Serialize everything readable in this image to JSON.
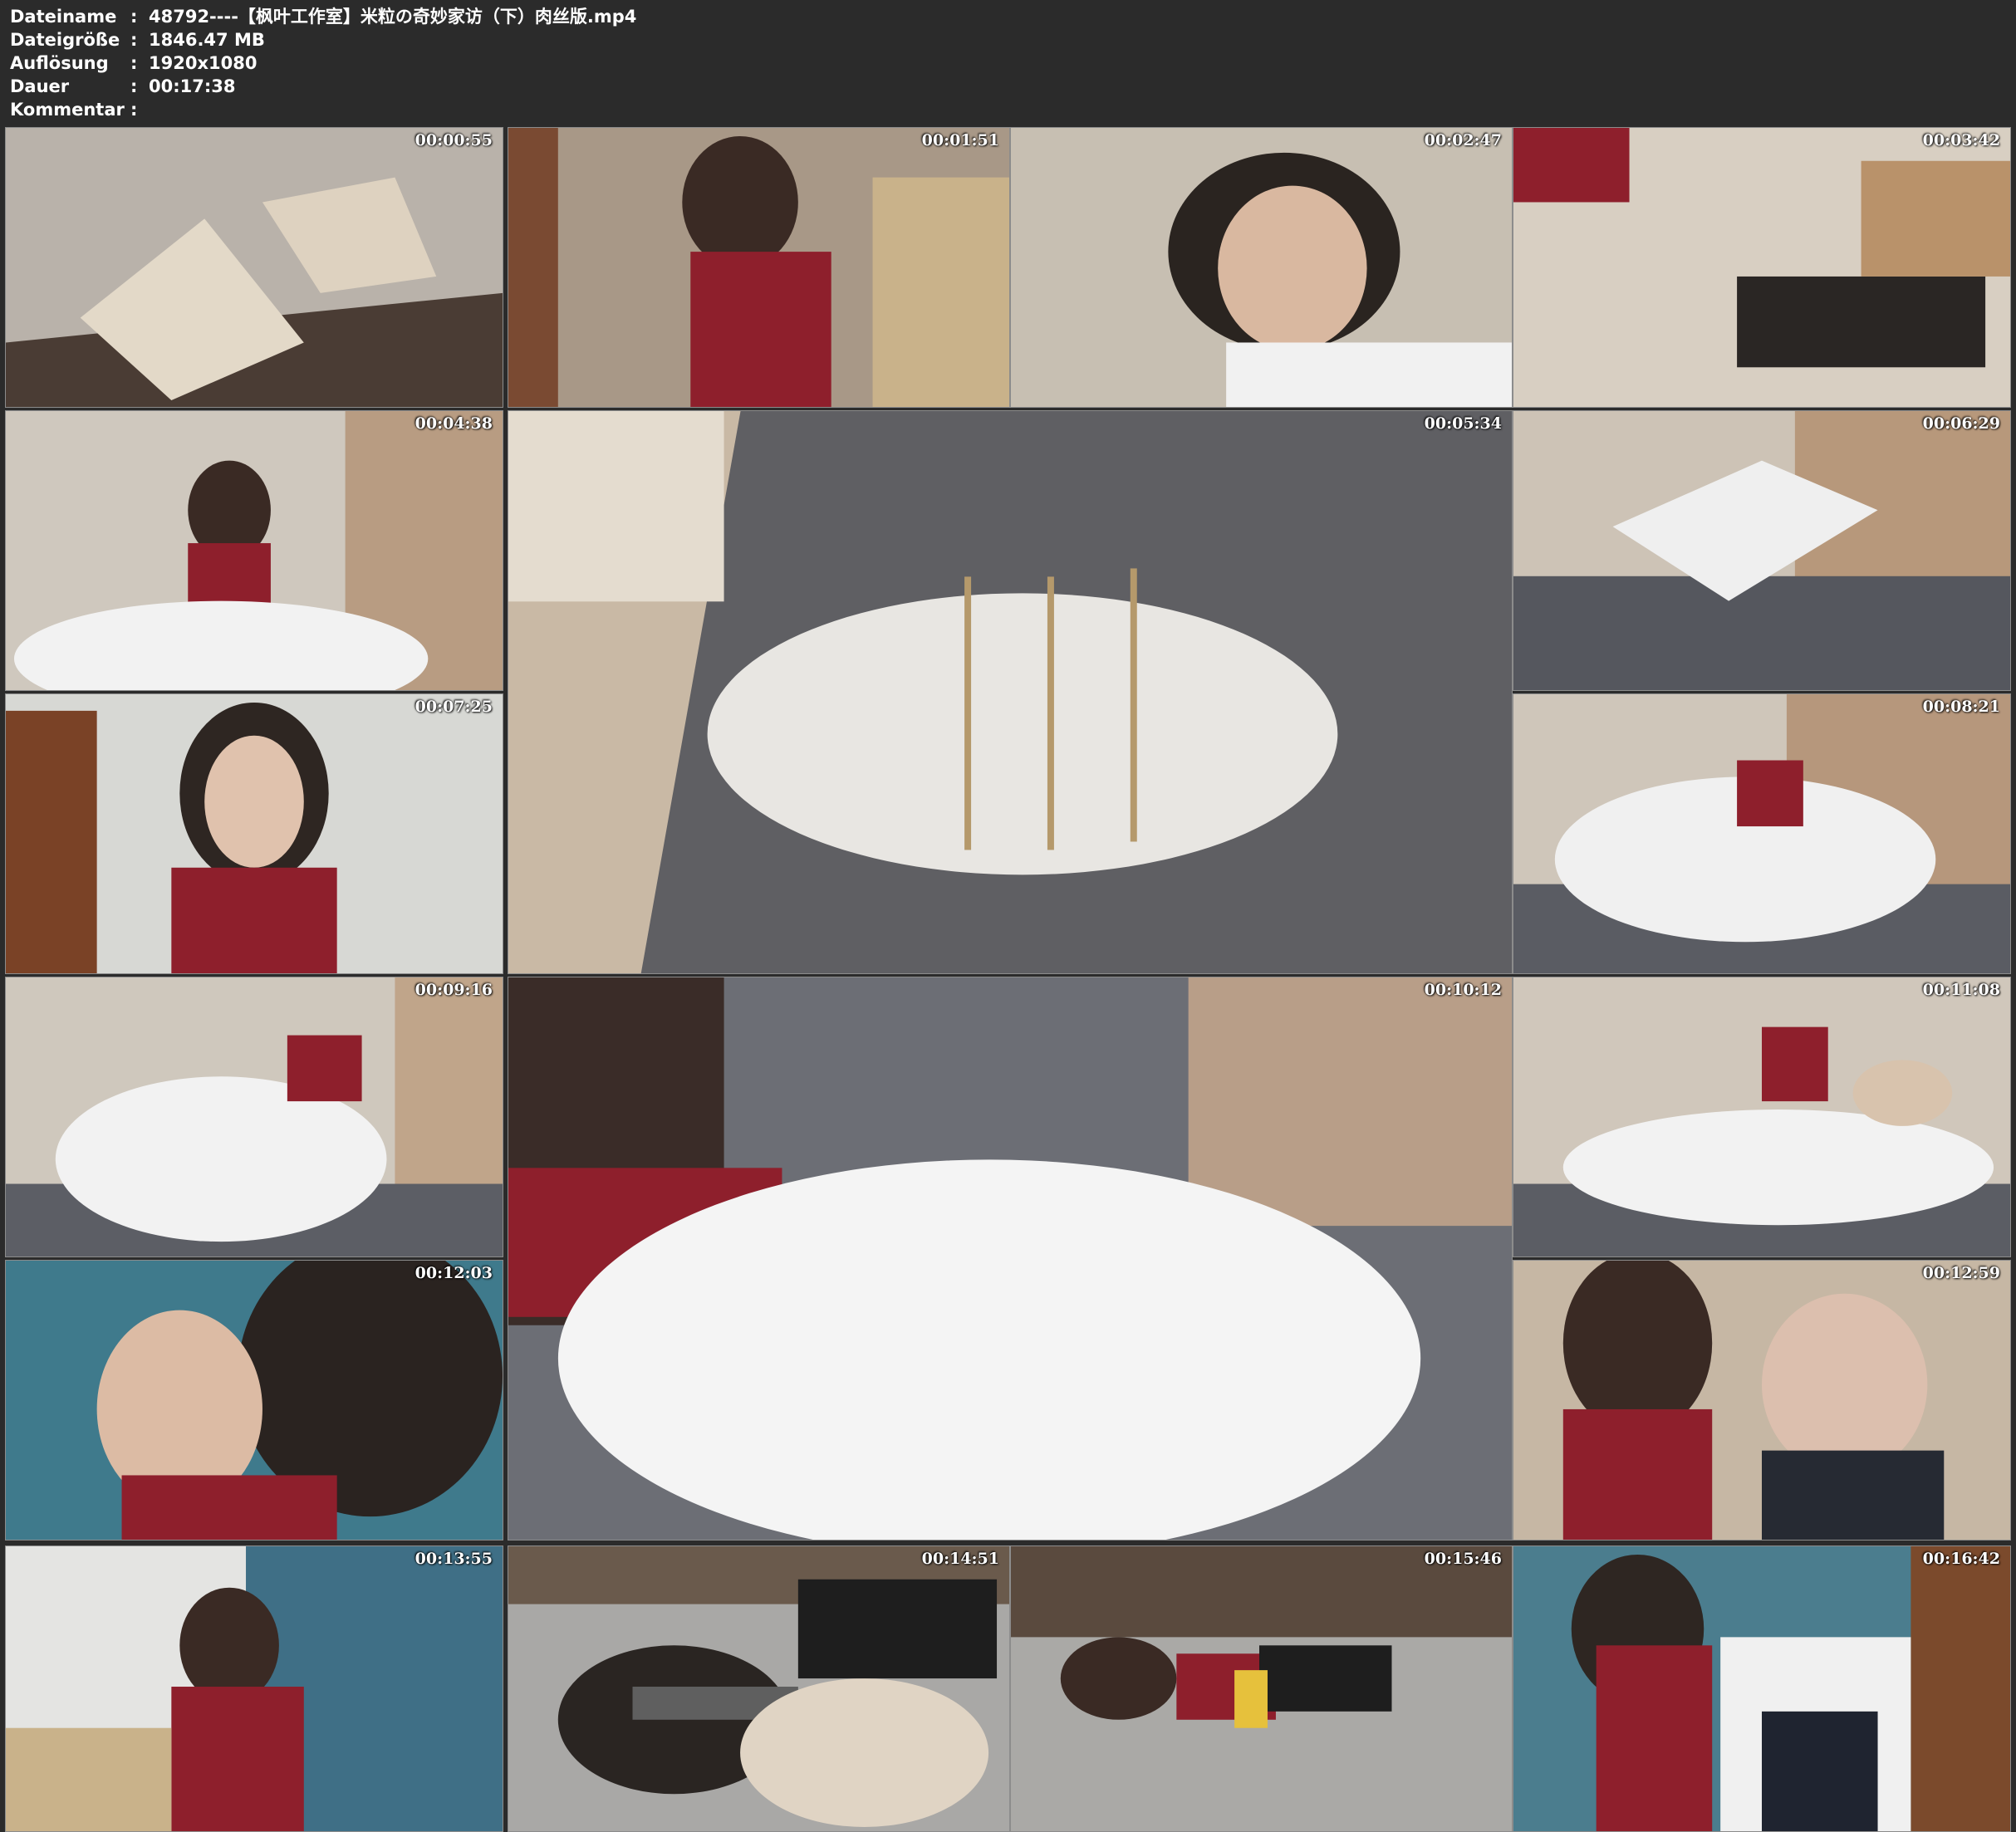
{
  "header": {
    "rows": [
      {
        "label": "Dateiname",
        "sep": ":",
        "value": "48792----【枫叶工作室】米粒の奇妙家访（下）肉丝版.mp4"
      },
      {
        "label": "Dateigröße",
        "sep": ":",
        "value": "1846.47 MB"
      },
      {
        "label": "Auflösung",
        "sep": ":",
        "value": "1920x1080"
      },
      {
        "label": "Dauer",
        "sep": ":",
        "value": "00:17:38"
      },
      {
        "label": "Kommentar",
        "sep": ":",
        "value": ""
      }
    ]
  },
  "thumbnails": [
    {
      "time": "00:00:55"
    },
    {
      "time": "00:01:51"
    },
    {
      "time": "00:02:47"
    },
    {
      "time": "00:03:42"
    },
    {
      "time": "00:04:38"
    },
    {
      "time": "00:05:34"
    },
    {
      "time": "00:06:29"
    },
    {
      "time": "00:07:25"
    },
    {
      "time": "00:08:21"
    },
    {
      "time": "00:09:16"
    },
    {
      "time": "00:10:12"
    },
    {
      "time": "00:11:08"
    },
    {
      "time": "00:12:03"
    },
    {
      "time": "00:12:59"
    },
    {
      "time": "00:13:55"
    },
    {
      "time": "00:14:51"
    },
    {
      "time": "00:15:46"
    },
    {
      "time": "00:16:42"
    }
  ]
}
